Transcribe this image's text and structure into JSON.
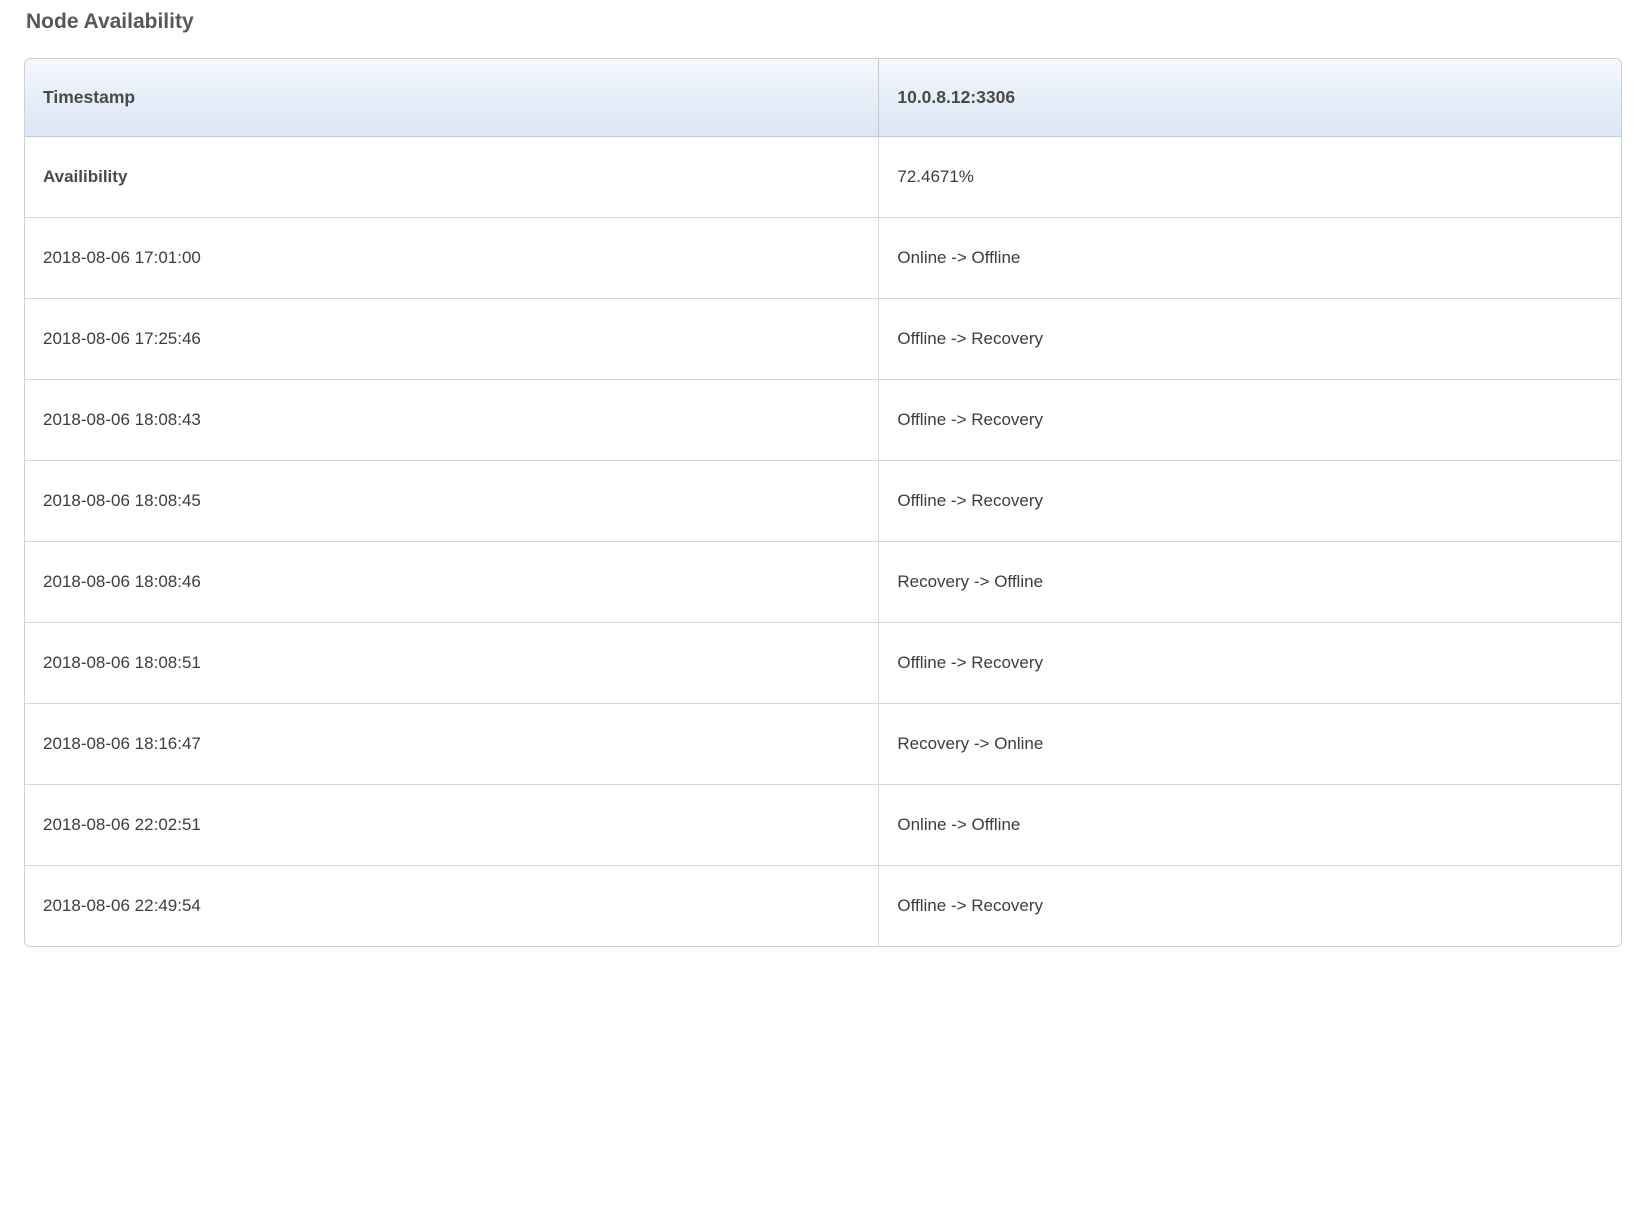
{
  "section": {
    "title": "Node Availability"
  },
  "table": {
    "headers": {
      "timestamp": "Timestamp",
      "node": "10.0.8.12:3306"
    },
    "availability_row": {
      "label": "Availibility",
      "value": "72.4671%"
    },
    "rows": [
      {
        "timestamp": "2018-08-06 17:01:00",
        "status": "Online -> Offline"
      },
      {
        "timestamp": "2018-08-06 17:25:46",
        "status": "Offline -> Recovery"
      },
      {
        "timestamp": "2018-08-06 18:08:43",
        "status": "Offline -> Recovery"
      },
      {
        "timestamp": "2018-08-06 18:08:45",
        "status": "Offline -> Recovery"
      },
      {
        "timestamp": "2018-08-06 18:08:46",
        "status": "Recovery -> Offline"
      },
      {
        "timestamp": "2018-08-06 18:08:51",
        "status": "Offline -> Recovery"
      },
      {
        "timestamp": "2018-08-06 18:16:47",
        "status": "Recovery -> Online"
      },
      {
        "timestamp": "2018-08-06 22:02:51",
        "status": "Online -> Offline"
      },
      {
        "timestamp": "2018-08-06 22:49:54",
        "status": "Offline -> Recovery"
      }
    ]
  }
}
